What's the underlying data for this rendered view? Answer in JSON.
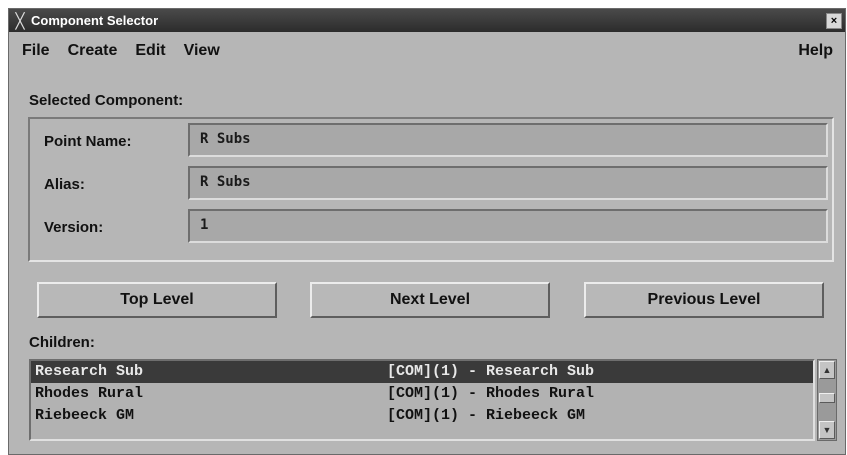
{
  "window": {
    "title": "Component Selector",
    "close_glyph": "×"
  },
  "menu": {
    "file": "File",
    "create": "Create",
    "edit": "Edit",
    "view": "View",
    "help": "Help"
  },
  "selected": {
    "heading": "Selected Component:",
    "point_name_label": "Point Name:",
    "point_name_value": "R Subs",
    "alias_label": "Alias:",
    "alias_value": "R Subs",
    "version_label": "Version:",
    "version_value": "1"
  },
  "buttons": {
    "top_level": "Top Level",
    "next_level": "Next Level",
    "previous_level": "Previous Level"
  },
  "children": {
    "heading": "Children:",
    "items": [
      {
        "name": "Research Sub",
        "desc": "[COM](1) - Research Sub"
      },
      {
        "name": "Rhodes Rural",
        "desc": "[COM](1) - Rhodes Rural"
      },
      {
        "name": "Riebeeck GM",
        "desc": "[COM](1) - Riebeeck GM"
      }
    ]
  },
  "colors": {
    "window_bg": "#b6b6b6",
    "titlebar_bg": "#2c2c2c",
    "selection_bg": "#3a3a3a"
  }
}
